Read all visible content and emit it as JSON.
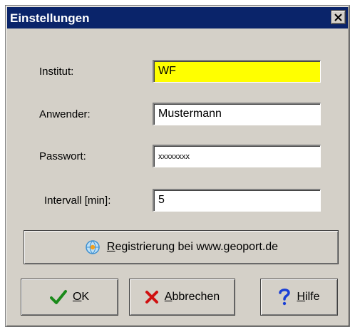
{
  "window": {
    "title": "Einstellungen",
    "close_label": "×"
  },
  "form": {
    "institut": {
      "label": "Institut:",
      "value": "WF",
      "highlight_color": "#ffff00"
    },
    "anwender": {
      "label": "Anwender:",
      "value": "Mustermann"
    },
    "passwort": {
      "label": "Passwort:",
      "value": "xxxxxxxx"
    },
    "intervall": {
      "label": "Intervall [min]:",
      "value": "5"
    }
  },
  "buttons": {
    "register": {
      "label": "Registrierung bei www.geoport.de",
      "icon": "globe-icon"
    },
    "ok": {
      "label": "OK",
      "icon": "checkmark-icon",
      "icon_color": "#1a8a1a"
    },
    "cancel": {
      "label": "Abbrechen",
      "icon": "red-x-icon",
      "icon_color": "#d01010"
    },
    "help": {
      "label": "Hilfe",
      "icon": "question-mark-icon",
      "icon_color": "#1a3fd6"
    }
  }
}
